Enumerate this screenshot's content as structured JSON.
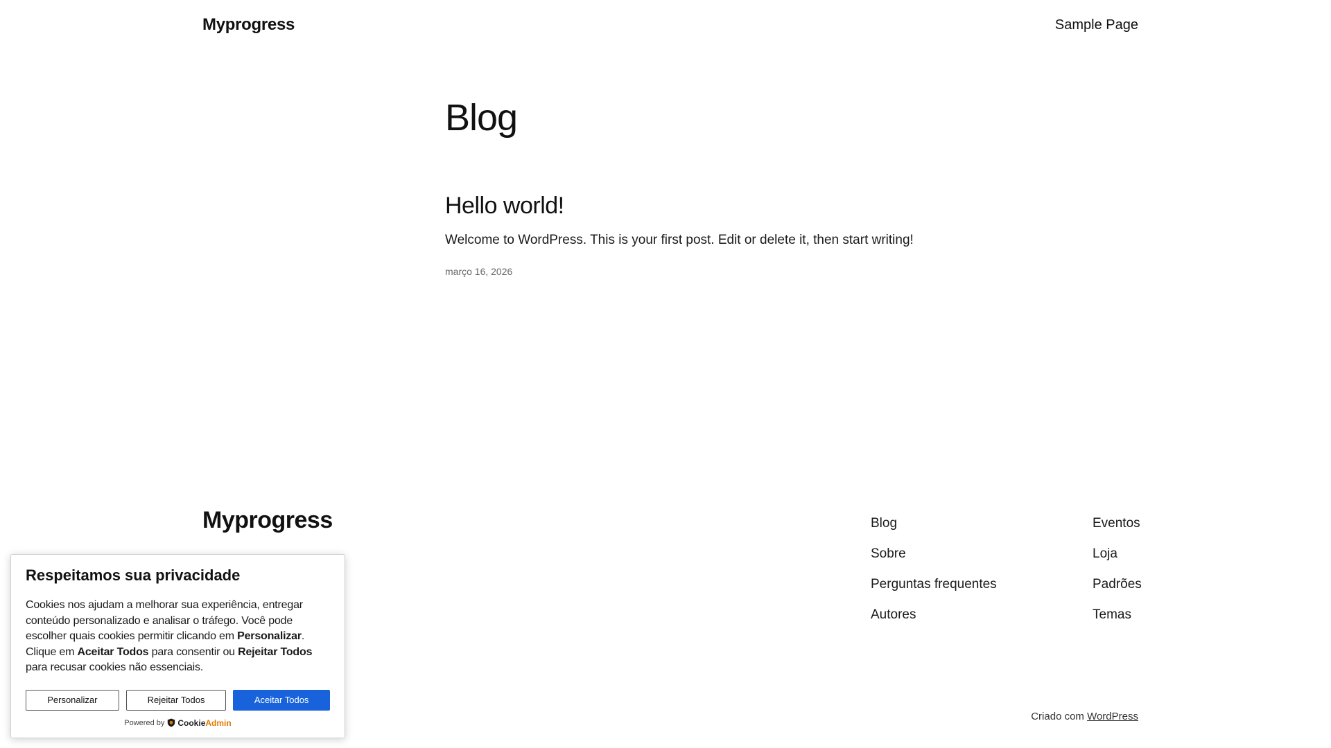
{
  "header": {
    "site_title": "Myprogress",
    "nav": [
      "Sample Page"
    ]
  },
  "main": {
    "page_title": "Blog",
    "posts": [
      {
        "title": "Hello world!",
        "excerpt": "Welcome to WordPress. This is your first post. Edit or delete it, then start writing!",
        "date": "março 16, 2026"
      }
    ]
  },
  "footer": {
    "site_title": "Myprogress",
    "col1": [
      "Blog",
      "Sobre",
      "Perguntas frequentes",
      "Autores"
    ],
    "col2": [
      "Eventos",
      "Loja",
      "Padrões",
      "Temas"
    ],
    "credits_prefix": "Criado com ",
    "credits_link": "WordPress"
  },
  "cookie_banner": {
    "title": "Respeitamos sua privacidade",
    "text_parts": [
      "Cookies nos ajudam a melhorar sua experiência, entregar conteúdo personalizado e analisar o tráfego. Você pode escolher quais cookies permitir clicando em ",
      "Personalizar",
      ". Clique em ",
      "Aceitar Todos",
      " para consentir ou ",
      "Rejeitar Todos",
      " para recusar cookies não essenciais."
    ],
    "buttons": {
      "customize": "Personalizar",
      "reject": "Rejeitar Todos",
      "accept": "Aceitar Todos"
    },
    "powered_by": "Powered by",
    "brand_part1": "Cookie",
    "brand_part2": "Admin",
    "accent_color": "#1863dc"
  }
}
